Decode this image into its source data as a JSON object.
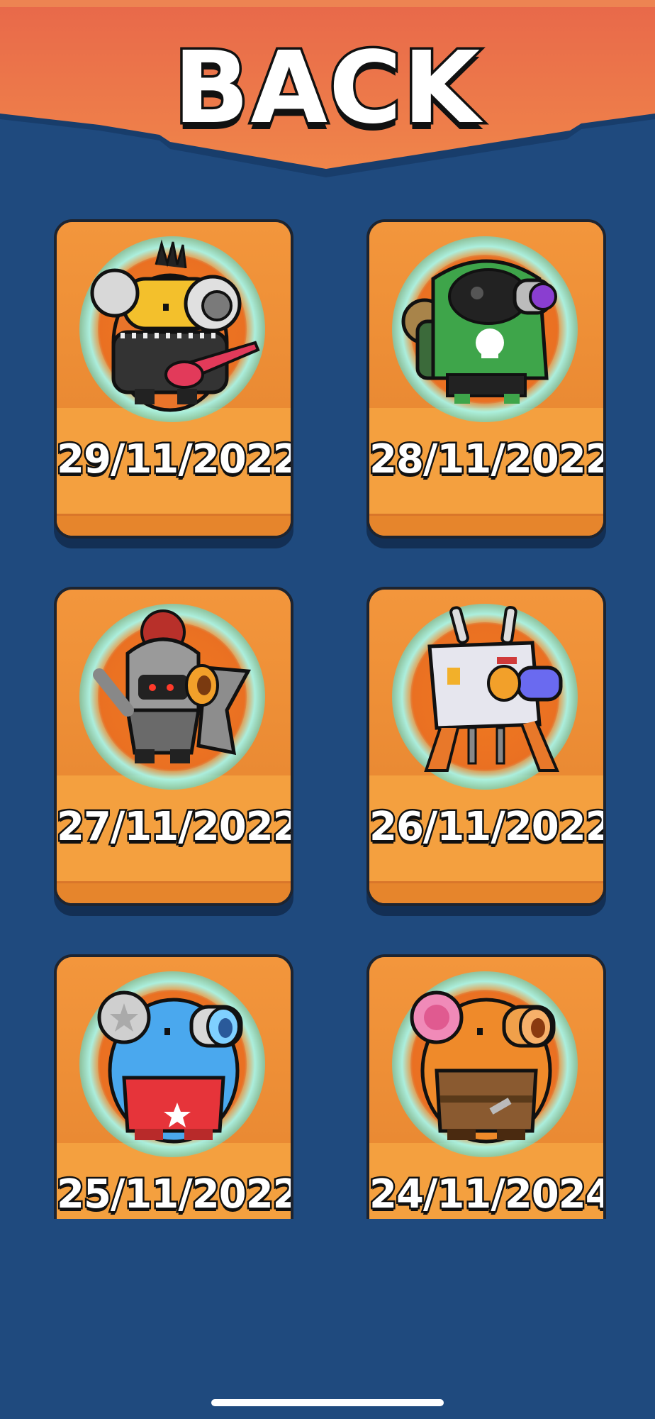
{
  "header": {
    "back_label": "BACK"
  },
  "cards": [
    {
      "date": "29/11/2022",
      "character": "punk-guitarist-character"
    },
    {
      "date": "28/11/2022",
      "character": "gas-mask-hoodie-character"
    },
    {
      "date": "27/11/2022",
      "character": "knight-helmet-character"
    },
    {
      "date": "26/11/2022",
      "character": "robot-walker-character"
    },
    {
      "date": "25/11/2022",
      "character": "blue-wrestler-character"
    },
    {
      "date": "24/11/2024",
      "character": "orange-pink-character"
    }
  ],
  "colors": {
    "background": "#1f4a7e",
    "banner": "#ec7a4a",
    "card": "#f1913a",
    "aura": "#7ef0ee"
  }
}
